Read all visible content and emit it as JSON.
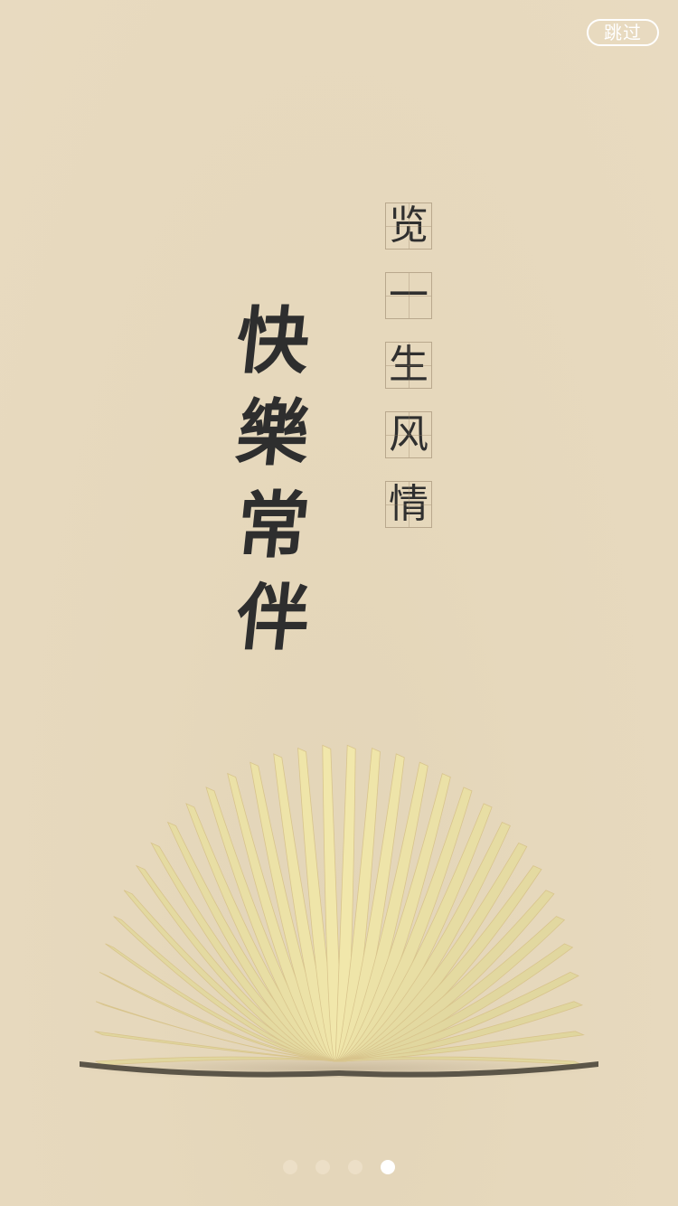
{
  "skip_button": {
    "label": "跳过"
  },
  "tagline": {
    "small_chars": [
      "览",
      "一",
      "生",
      "风",
      "情"
    ],
    "large_chars": [
      "快",
      "樂",
      "常",
      "伴"
    ]
  },
  "colors": {
    "background": "#e7d9bd",
    "ink": "#2e2e2e",
    "page": "#efe0ad",
    "dot_inactive": "#ecdfc7",
    "dot_active": "#ffffff"
  },
  "pager": {
    "total": 4,
    "active_index": 3
  },
  "icons": {
    "illustration": "open-book-illustration"
  }
}
